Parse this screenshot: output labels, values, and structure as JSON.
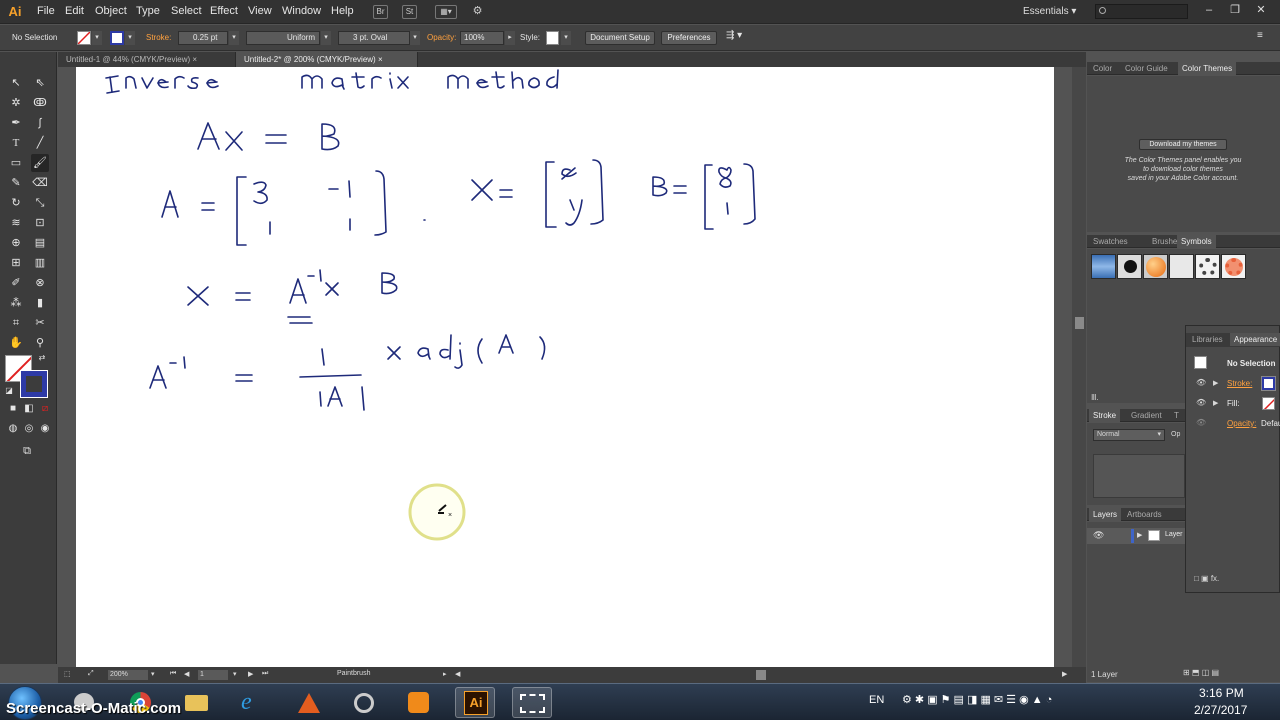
{
  "app": {
    "logo": "Ai"
  },
  "menu": [
    "File",
    "Edit",
    "Object",
    "Type",
    "Select",
    "Effect",
    "View",
    "Window",
    "Help"
  ],
  "menubar_icons": {
    "bridge": "Br",
    "stock": "St"
  },
  "workspace": "Essentials",
  "window_controls": {
    "minimize": "–",
    "maximize": "❐",
    "close": "✕"
  },
  "control": {
    "selection": "No Selection",
    "stroke_label": "Stroke:",
    "stroke_weight": "0.25 pt",
    "profile": "Uniform",
    "brush": "3 pt. Oval",
    "opacity_label": "Opacity:",
    "opacity": "100%",
    "style_label": "Style:",
    "document_setup": "Document Setup",
    "preferences": "Preferences"
  },
  "tabs": [
    {
      "label": "Untitled-1 @ 44% (CMYK/Preview)",
      "close": "×"
    },
    {
      "label": "Untitled-2* @ 200% (CMYK/Preview)",
      "close": "×"
    }
  ],
  "status": {
    "zoom": "200%",
    "artboard": "1",
    "tool": "Paintbrush"
  },
  "color_panel": {
    "tabs": [
      "Color",
      "Color Guide",
      "Color Themes"
    ],
    "button": "Download my themes",
    "message": [
      "The Color Themes panel enables you",
      "to download color themes",
      "saved in your Adobe Color account."
    ]
  },
  "symbols_panel": {
    "tabs": [
      "Swatches",
      "Brushes",
      "Symbols"
    ]
  },
  "stroke_panel": {
    "tabs": [
      "Stroke",
      "Gradient",
      "T"
    ],
    "blend_mode": "Normal",
    "opacity_prefix": "Op"
  },
  "layers_panel": {
    "tabs": [
      "Layers",
      "Artboards"
    ],
    "layer_name": "Layer",
    "footer": "1 Layer"
  },
  "appearance_panel": {
    "tabs": [
      "Libraries",
      "Appearance"
    ],
    "title": "No Selection",
    "stroke_label": "Stroke:",
    "fill_label": "Fill:",
    "opacity_label": "Opacity:",
    "opacity_value": "Defau"
  },
  "taskbar": {
    "watermark": "Screencast-O-Matic.com",
    "language": "EN",
    "time": "3:16 PM",
    "date": "2/27/2017",
    "apps": [
      "ie-icon",
      "matlab-icon",
      "media-icon",
      "player-icon",
      "illustrator-icon",
      "screen-capture-icon"
    ],
    "illustrator_label": "Ai"
  },
  "colors": {
    "ui_dark": "#323232",
    "accent_orange": "#ffa13f",
    "ink_blue": "#1e2a7a",
    "stroke_blue": "#2d3aa6"
  }
}
